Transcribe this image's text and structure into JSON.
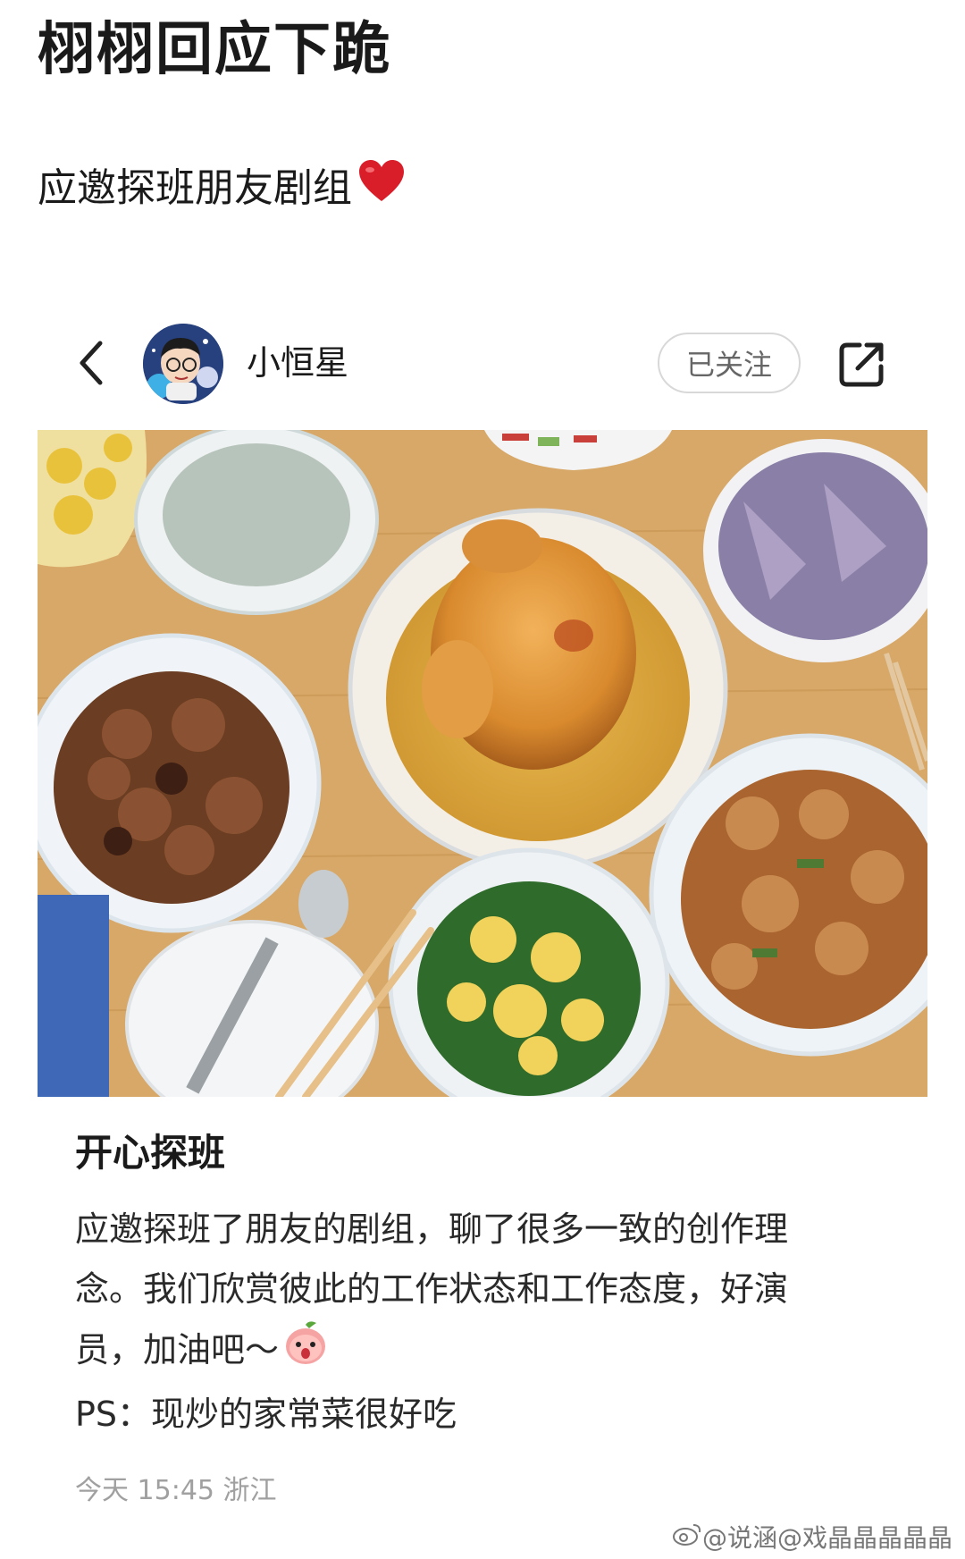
{
  "headline": "栩栩回应下跪",
  "subline": "应邀探班朋友剧组",
  "post": {
    "author": "小恒星",
    "follow_label": "已关注",
    "title": "开心探班",
    "body_lines": [
      "应邀探班了朋友的剧组，聊了很多一致的创作理",
      "念。我们欣赏彼此的工作状态和工作态度，好演",
      "员，加油吧～",
      "PS：现炒的家常菜很好吃"
    ],
    "meta": "今天 15:45 浙江"
  },
  "watermark": "@说涵@戏晶晶晶晶晶",
  "icons": {
    "back": "chevron-left-icon",
    "share": "share-icon",
    "heart": "heart-emoji",
    "emoji": "peach-face-emoji"
  },
  "colors": {
    "heart": "#d91e2a",
    "follow_border": "#d8d8d8",
    "meta": "#a0a0a0"
  }
}
